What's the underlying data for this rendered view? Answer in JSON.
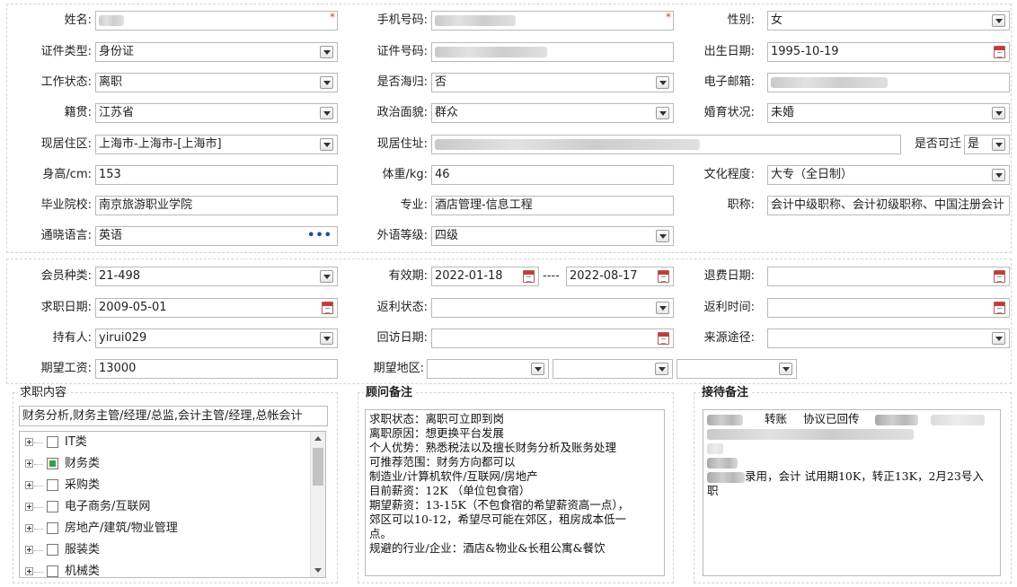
{
  "basic": {
    "name_label": "姓名:",
    "mobile_label": "手机号码:",
    "gender_label": "性别:",
    "gender_value": "女",
    "idtype_label": "证件类型:",
    "idtype_value": "身份证",
    "idno_label": "证件号码:",
    "birth_label": "出生日期:",
    "birth_value": "1995-10-19",
    "workstatus_label": "工作状态:",
    "workstatus_value": "离职",
    "returnee_label": "是否海归:",
    "returnee_value": "否",
    "email_label": "电子邮箱:",
    "origin_label": "籍贯:",
    "origin_value": "江苏省",
    "political_label": "政治面貌:",
    "political_value": "群众",
    "marital_label": "婚育状况:",
    "marital_value": "未婚",
    "residence_label": "现居住区:",
    "residence_value": "上海市-上海市-[上海市]",
    "address_label": "现居住址:",
    "relocate_label": "是否可迁",
    "relocate_value": "是",
    "height_label": "身高/cm:",
    "height_value": "153",
    "weight_label": "体重/kg:",
    "weight_value": "46",
    "education_label": "文化程度:",
    "education_value": "大专（全日制）",
    "school_label": "毕业院校:",
    "school_value": "南京旅游职业学院",
    "major_label": "专业:",
    "major_value": "酒店管理-信息工程",
    "title_label": "职称:",
    "title_value": "会计中级职称、会计初级职称、中国注册会计",
    "language_label": "通晓语言:",
    "language_value": "英语",
    "foreign_label": "外语等级:",
    "foreign_value": "四级"
  },
  "member": {
    "type_label": "会员种类:",
    "type_value": "21-498",
    "valid_label": "有效期:",
    "valid_from": "2022-01-18",
    "valid_sep": "----",
    "valid_to": "2022-08-17",
    "refund_label": "退费日期:",
    "apply_label": "求职日期:",
    "apply_value": "2009-05-01",
    "rebate_status_label": "返利状态:",
    "rebate_time_label": "返利时间:",
    "holder_label": "持有人:",
    "holder_value": "yirui029",
    "visit_label": "回访日期:",
    "source_label": "来源途径:",
    "salary_label": "期望工资:",
    "salary_value": "13000",
    "region_label": "期望地区:"
  },
  "job": {
    "title": "求职内容",
    "summary": "财务分析,财务主管/经理/总监,会计主管/经理,总帐会计",
    "tree": [
      {
        "label": "IT类",
        "checked": false
      },
      {
        "label": "财务类",
        "checked": true
      },
      {
        "label": "采购类",
        "checked": false
      },
      {
        "label": "电子商务/互联网",
        "checked": false
      },
      {
        "label": "房地产/建筑/物业管理",
        "checked": false
      },
      {
        "label": "服装类",
        "checked": false
      },
      {
        "label": "机械类",
        "checked": false
      }
    ]
  },
  "advisor": {
    "title": "顾问备注",
    "lines": [
      "求职状态：离职可立即到岗",
      "离职原因：想更换平台发展",
      "个人优势：熟悉税法以及擅长财务分析及账务处理",
      "可推荐范围：财务方向都可以",
      "制造业/计算机软件/互联网/房地产",
      "目前薪资：12K （单位包食宿）",
      "期望薪资：13-15K（不包食宿的希望薪资高一点），",
      "郊区可以10-12，希望尽可能在郊区，租房成本低一",
      "点。",
      "规避的行业/企业：酒店&物业&长租公寓&餐饮"
    ]
  },
  "reception": {
    "title": "接待备注",
    "fragment_1": "转账",
    "fragment_2": "协议已回传",
    "line_hire_1": "录用，会计 试用期10K，转正13K，2月23号入",
    "line_hire_2": "职"
  }
}
